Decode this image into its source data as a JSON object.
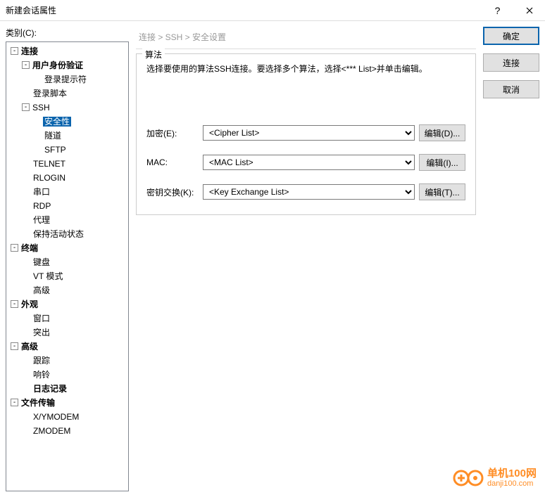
{
  "window": {
    "title": "新建会话属性",
    "help": "?",
    "close": "×"
  },
  "category_label": "类别(C):",
  "tree": [
    {
      "ind": 0,
      "exp": "-",
      "label": "连接",
      "bold": true,
      "name": "tree-connection"
    },
    {
      "ind": 1,
      "exp": "-",
      "label": "用户身份验证",
      "bold": true,
      "name": "tree-auth"
    },
    {
      "ind": 2,
      "exp": "",
      "label": "登录提示符",
      "name": "tree-login-prompt"
    },
    {
      "ind": 1,
      "exp": "",
      "label": "登录脚本",
      "name": "tree-login-script"
    },
    {
      "ind": 1,
      "exp": "-",
      "label": "SSH",
      "name": "tree-ssh"
    },
    {
      "ind": 2,
      "exp": "",
      "label": "安全性",
      "selected": true,
      "name": "tree-security"
    },
    {
      "ind": 2,
      "exp": "",
      "label": "隧道",
      "name": "tree-tunnel"
    },
    {
      "ind": 2,
      "exp": "",
      "label": "SFTP",
      "name": "tree-sftp"
    },
    {
      "ind": 1,
      "exp": "",
      "label": "TELNET",
      "name": "tree-telnet"
    },
    {
      "ind": 1,
      "exp": "",
      "label": "RLOGIN",
      "name": "tree-rlogin"
    },
    {
      "ind": 1,
      "exp": "",
      "label": "串口",
      "name": "tree-serial"
    },
    {
      "ind": 1,
      "exp": "",
      "label": "RDP",
      "name": "tree-rdp"
    },
    {
      "ind": 1,
      "exp": "",
      "label": "代理",
      "name": "tree-proxy"
    },
    {
      "ind": 1,
      "exp": "",
      "label": "保持活动状态",
      "name": "tree-keepalive"
    },
    {
      "ind": 0,
      "exp": "-",
      "label": "终端",
      "bold": true,
      "name": "tree-terminal"
    },
    {
      "ind": 1,
      "exp": "",
      "label": "键盘",
      "name": "tree-keyboard"
    },
    {
      "ind": 1,
      "exp": "",
      "label": "VT 模式",
      "name": "tree-vtmode"
    },
    {
      "ind": 1,
      "exp": "",
      "label": "高级",
      "name": "tree-term-adv"
    },
    {
      "ind": 0,
      "exp": "-",
      "label": "外观",
      "bold": true,
      "name": "tree-appearance"
    },
    {
      "ind": 1,
      "exp": "",
      "label": "窗口",
      "name": "tree-window"
    },
    {
      "ind": 1,
      "exp": "",
      "label": "突出",
      "name": "tree-highlight"
    },
    {
      "ind": 0,
      "exp": "-",
      "label": "高级",
      "bold": true,
      "name": "tree-advanced"
    },
    {
      "ind": 1,
      "exp": "",
      "label": "跟踪",
      "name": "tree-trace"
    },
    {
      "ind": 1,
      "exp": "",
      "label": "响铃",
      "name": "tree-bell"
    },
    {
      "ind": 1,
      "exp": "",
      "label": "日志记录",
      "bold": true,
      "name": "tree-logging"
    },
    {
      "ind": 0,
      "exp": "-",
      "label": "文件传输",
      "bold": true,
      "name": "tree-filetransfer"
    },
    {
      "ind": 1,
      "exp": "",
      "label": "X/YMODEM",
      "name": "tree-xymodem"
    },
    {
      "ind": 1,
      "exp": "",
      "label": "ZMODEM",
      "name": "tree-zmodem"
    }
  ],
  "breadcrumb": "连接 > SSH > 安全设置",
  "group_title": "算法",
  "instruction": "选择要使用的算法SSH连接。要选择多个算法，选择<*** List>并单击编辑。",
  "rows": {
    "encrypt": {
      "label": "加密(E):",
      "value": "<Cipher List>",
      "btn": "编辑(D)..."
    },
    "mac": {
      "label": "MAC:",
      "value": "<MAC List>",
      "btn": "编辑(I)..."
    },
    "kex": {
      "label": "密钥交换(K):",
      "value": "<Key Exchange List>",
      "btn": "编辑(T)..."
    }
  },
  "buttons": {
    "ok": "确定",
    "connect": "连接",
    "cancel": "取消"
  },
  "watermark": {
    "top": "单机100网",
    "bottom": "danji100.com"
  }
}
